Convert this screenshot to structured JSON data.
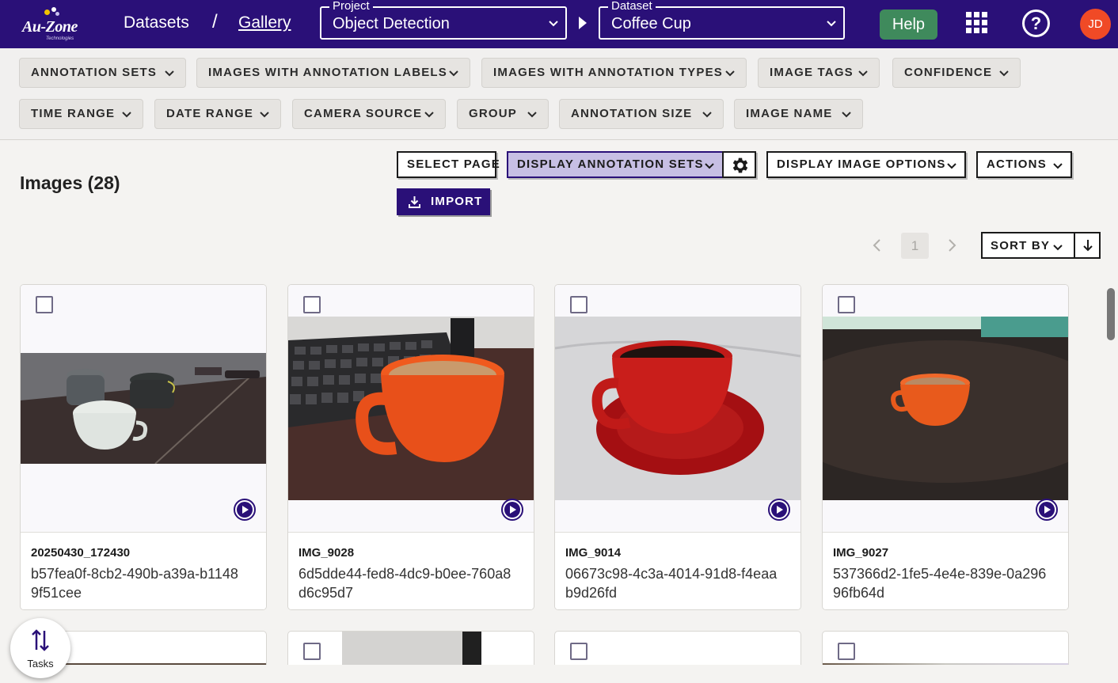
{
  "header": {
    "logo_text": "Au-Zone",
    "logo_sub": "Technologies",
    "breadcrumb": {
      "datasets": "Datasets",
      "separator": "/",
      "gallery": "Gallery"
    },
    "project": {
      "label": "Project",
      "value": "Object Detection"
    },
    "dataset": {
      "label": "Dataset",
      "value": "Coffee Cup"
    },
    "help_label": "Help",
    "help_icon_glyph": "?",
    "avatar_initials": "JD",
    "colors": {
      "bar": "#2a1078",
      "help": "#3f8a5c",
      "avatar": "#f04a26"
    }
  },
  "filters": {
    "row1": [
      "ANNOTATION SETS",
      "IMAGES WITH ANNOTATION LABELS",
      "IMAGES WITH ANNOTATION TYPES",
      "IMAGE TAGS",
      "CONFIDENCE"
    ],
    "row2": [
      "TIME RANGE",
      "DATE RANGE",
      "CAMERA SOURCE",
      "GROUP",
      "ANNOTATION SIZE",
      "IMAGE NAME"
    ]
  },
  "toolbar": {
    "images_title": "Images (28)",
    "select_page": "SELECT PAGE",
    "display_annotation_sets": "DISPLAY ANNOTATION SETS",
    "display_image_options": "DISPLAY IMAGE OPTIONS",
    "actions": "ACTIONS",
    "import": "IMPORT"
  },
  "pagination": {
    "current_page": "1"
  },
  "sort": {
    "label": "SORT BY",
    "direction": "descending"
  },
  "cards": [
    {
      "name": "20250430_172430",
      "uid": "b57fea0f-8cb2-490b-a39a-b11489f51cee",
      "thumb": "white and dark mugs on dark desk"
    },
    {
      "name": "IMG_9028",
      "uid": "6d5dde44-fed8-4dc9-b0ee-760a8d6c95d7",
      "thumb": "orange cup beside keyboard"
    },
    {
      "name": "IMG_9014",
      "uid": "06673c98-4c3a-4014-91d8-f4eaab9d26fd",
      "thumb": "red cup on saucer with coffee"
    },
    {
      "name": "IMG_9027",
      "uid": "537366d2-1fe5-4e4e-839e-0a29696fb64d",
      "thumb": "small orange cup on dark table"
    }
  ],
  "tasks": {
    "label": "Tasks"
  }
}
